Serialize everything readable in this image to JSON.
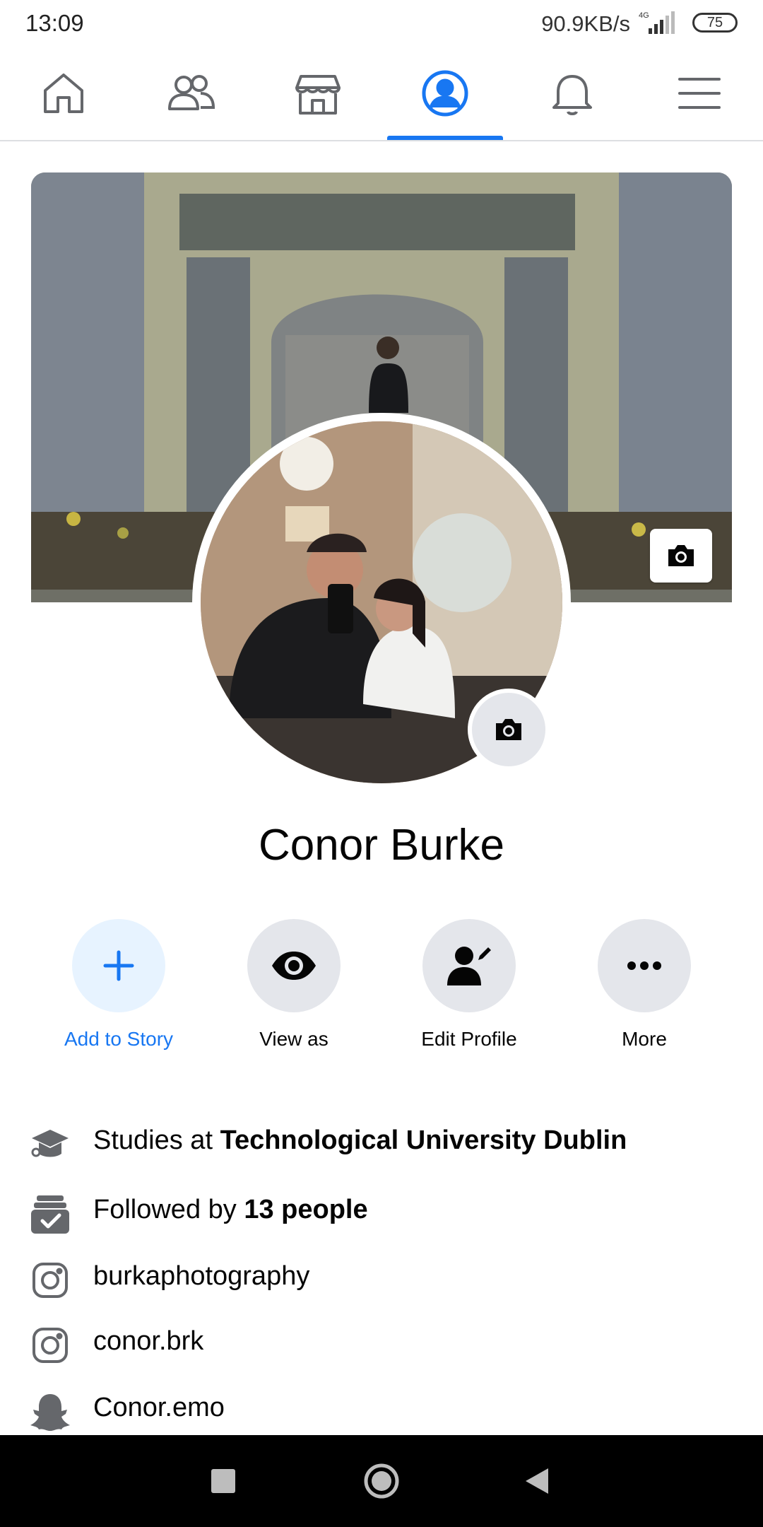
{
  "status_bar": {
    "time": "13:09",
    "network_speed": "90.9KB/s",
    "network_type": "4G",
    "battery": "75"
  },
  "nav": {
    "active_tab": "profile",
    "accent": "#1877f2",
    "tabs": [
      {
        "icon": "home-icon"
      },
      {
        "icon": "friends-icon"
      },
      {
        "icon": "marketplace-icon"
      },
      {
        "icon": "profile-icon"
      },
      {
        "icon": "bell-icon"
      },
      {
        "icon": "menu-icon"
      }
    ]
  },
  "profile": {
    "name": "Conor Burke"
  },
  "actions": {
    "add_to_story": "Add to Story",
    "view_as": "View as",
    "edit_profile": "Edit Profile",
    "more": "More"
  },
  "details": {
    "studies_prefix": "Studies at ",
    "studies_school": "Technological University Dublin",
    "followed_prefix": "Followed by ",
    "followed_count": "13 people",
    "instagram_1": "burkaphotography",
    "instagram_2": "conor.brk",
    "snapchat": "Conor.emo"
  }
}
